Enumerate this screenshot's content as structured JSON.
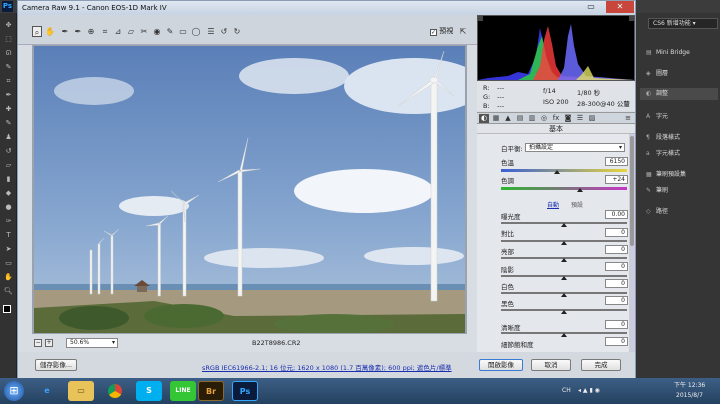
{
  "ps": {
    "logo": "Ps",
    "workspace": "CS6 新增功能 ▾",
    "panels": [
      {
        "label": "Mini Bridge",
        "icon": "mini-bridge-icon"
      },
      {
        "label": "圖層",
        "icon": "layers-icon"
      },
      {
        "label": "調整",
        "icon": "adjustments-icon"
      },
      {
        "label": "字元",
        "icon": "character-icon"
      },
      {
        "label": "段落樣式",
        "icon": "paragraph-styles-icon"
      },
      {
        "label": "字元樣式",
        "icon": "character-styles-icon"
      },
      {
        "label": "筆刷預設集",
        "icon": "brush-presets-icon"
      },
      {
        "label": "筆刷",
        "icon": "brush-icon"
      },
      {
        "label": "路徑",
        "icon": "paths-icon"
      }
    ]
  },
  "camera_raw": {
    "title": "Camera Raw 9.1  -  Canon EOS-1D Mark IV",
    "preview_label": "預視",
    "zoom": "50.6%",
    "filename": "B22T8986.CR2",
    "rgb": {
      "r": "R:",
      "g": "G:",
      "b": "B:",
      "dash": "---"
    },
    "exposure_info": {
      "aperture": "f/14",
      "shutter": "1/80 秒",
      "iso": "ISO 200",
      "lens": "28-300@40 公釐"
    },
    "panel_title": "基本",
    "wb_label": "白平衡:",
    "wb_value": "拍攝設定",
    "temp_label": "色溫",
    "temp_value": "6150",
    "tint_label": "色調",
    "tint_value": "+24",
    "auto": "自動",
    "default": "預設",
    "exposure_label": "曝光度",
    "exposure_value": "0.00",
    "contrast_label": "對比",
    "contrast_value": "0",
    "highlights_label": "亮部",
    "highlights_value": "0",
    "shadows_label": "陰影",
    "shadows_value": "0",
    "whites_label": "白色",
    "whites_value": "0",
    "blacks_label": "黑色",
    "blacks_value": "0",
    "clarity_label": "清晰度",
    "clarity_value": "0",
    "vibrance_label": "細節飽和度",
    "vibrance_value": "0",
    "save_btn": "儲存影像...",
    "workflow_link": "sRGB IEC61966-2.1; 16 位元; 1620 x 1080 (1.7 百萬像素); 600 ppi; 遮色片/標準",
    "open_btn": "開啟影像",
    "cancel_btn": "取消",
    "done_btn": "完成"
  },
  "taskbar": {
    "start_icon": "windows-start-icon",
    "lang": "CH",
    "time": "下午 12:36",
    "date": "2015/8/7",
    "apps": [
      "Br",
      "Ps"
    ]
  }
}
